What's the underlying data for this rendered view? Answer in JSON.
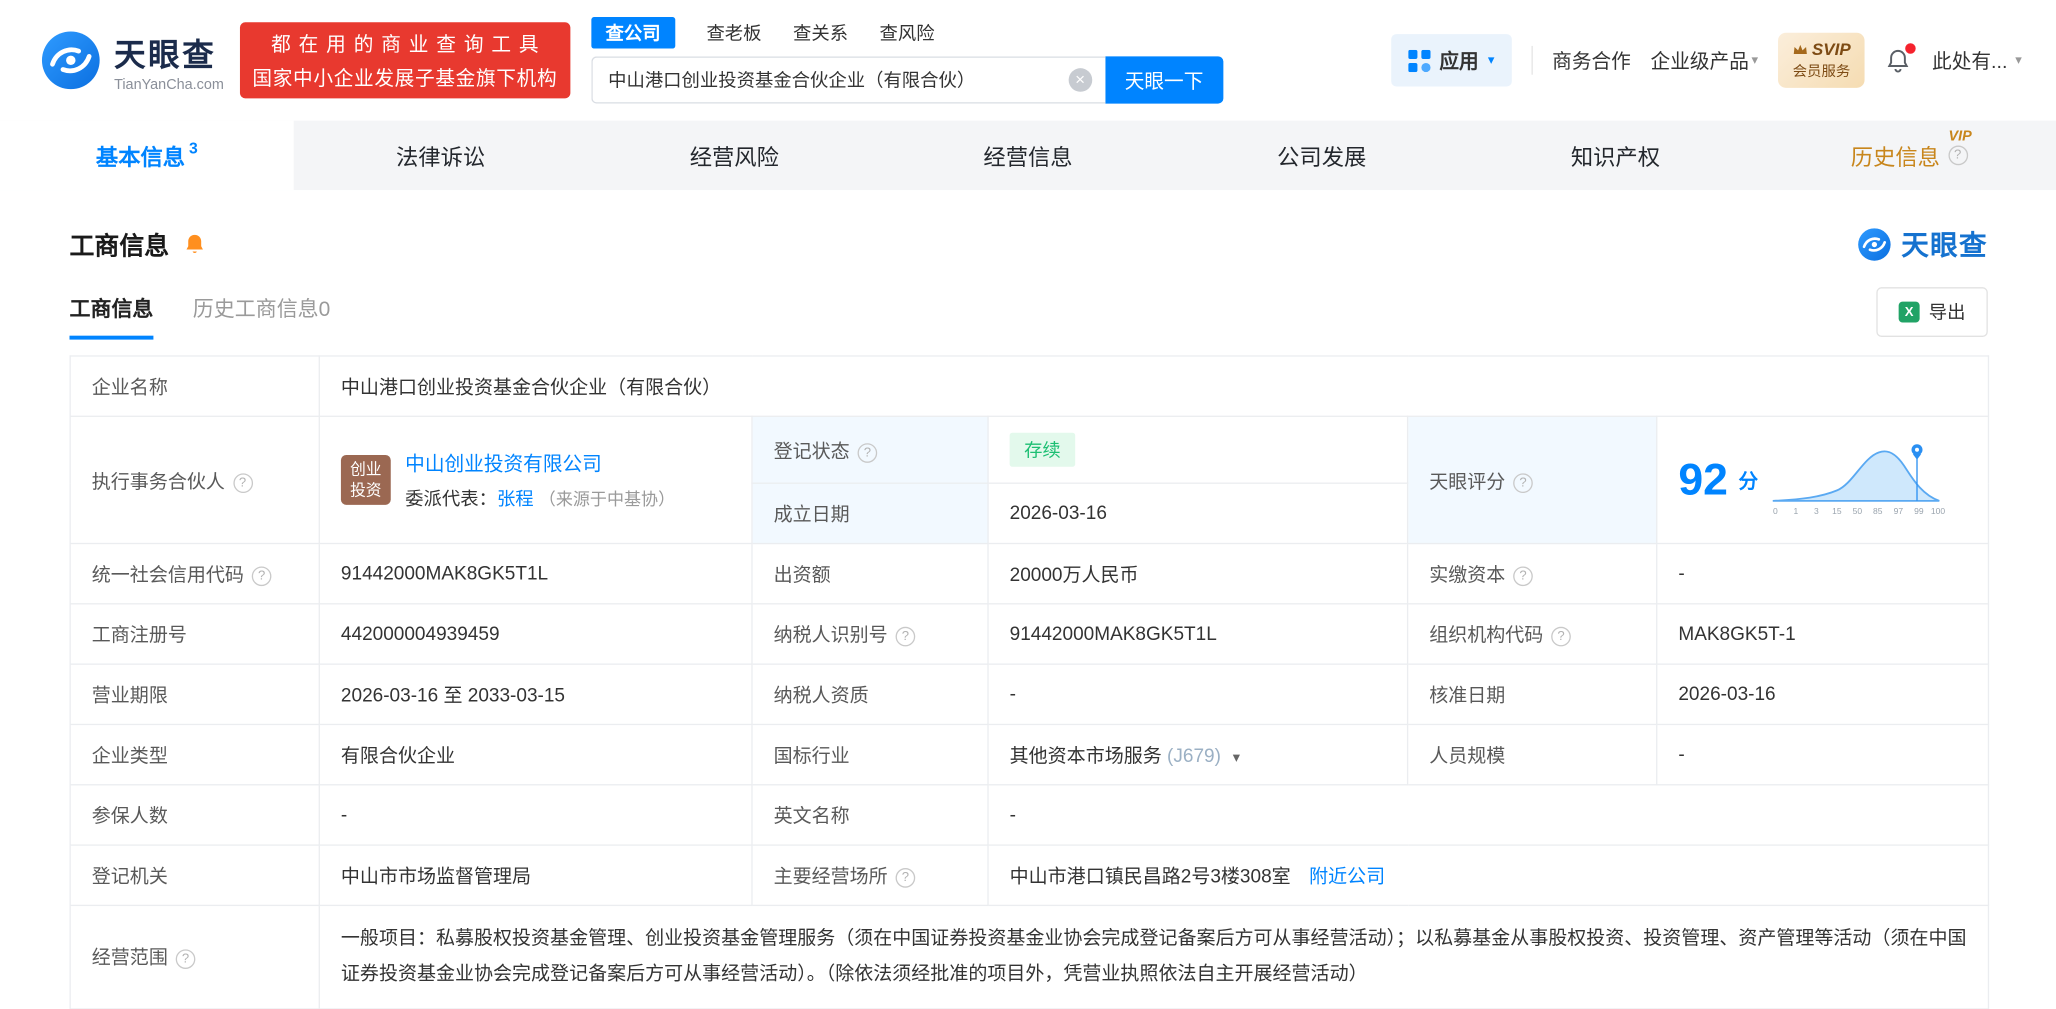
{
  "colors": {
    "accent": "#0084ff",
    "promo_red": "#e8392f",
    "gold": "#c8861c",
    "green": "#1dbf73",
    "brown": "#9b6852"
  },
  "icons": {
    "help": "?",
    "chevron_down": "▾",
    "clear": "×"
  },
  "header": {
    "brand": {
      "name": "天眼查",
      "domain": "TianYanCha.com"
    },
    "promo": {
      "line1": "都在用的商业查询工具",
      "line2": "国家中小企业发展子基金旗下机构"
    },
    "search": {
      "tabs": [
        {
          "label": "查公司"
        },
        {
          "label": "查老板"
        },
        {
          "label": "查关系"
        },
        {
          "label": "查风险"
        }
      ],
      "value": "中山港口创业投资基金合伙企业（有限合伙）",
      "button": "天眼一下"
    },
    "apps_label": "应用",
    "biz_link": "商务合作",
    "enterprise_link": "企业级产品",
    "svip": {
      "top": "SVIP",
      "bottom": "会员服务"
    },
    "more": "此处有..."
  },
  "nav": {
    "tabs": [
      {
        "label": "基本信息",
        "count": "3"
      },
      {
        "label": "法律诉讼"
      },
      {
        "label": "经营风险"
      },
      {
        "label": "经营信息"
      },
      {
        "label": "公司发展"
      },
      {
        "label": "知识产权"
      },
      {
        "label": "历史信息",
        "vip": "VIP"
      }
    ]
  },
  "section": {
    "title": "工商信息",
    "watermark": "天眼查",
    "subtabs": [
      {
        "label": "工商信息"
      },
      {
        "label": "历史工商信息0"
      }
    ],
    "export_label": "导出"
  },
  "table": {
    "company_name": {
      "label": "企业名称",
      "value": "中山港口创业投资基金合伙企业（有限合伙）"
    },
    "partner": {
      "label": "执行事务合伙人",
      "badge_line1": "创业",
      "badge_line2": "投资",
      "name": "中山创业投资有限公司",
      "rep_label": "委派代表：",
      "rep_name": "张程",
      "rep_note": "（来源于中基协）"
    },
    "reg_status": {
      "label": "登记状态",
      "value": "存续"
    },
    "establish_date": {
      "label": "成立日期",
      "value": "2026-03-16"
    },
    "score": {
      "label": "天眼评分",
      "value": "92",
      "unit": "分",
      "axis": [
        "0",
        "1",
        "3",
        "15",
        "50",
        "85",
        "97",
        "99",
        "100"
      ]
    },
    "credit_code": {
      "label": "统一社会信用代码",
      "value": "91442000MAK8GK5T1L"
    },
    "capital": {
      "label": "出资额",
      "value": "20000万人民币"
    },
    "paid_capital": {
      "label": "实缴资本",
      "value": "-"
    },
    "reg_number": {
      "label": "工商注册号",
      "value": "442000004939459"
    },
    "taxpayer_id": {
      "label": "纳税人识别号",
      "value": "91442000MAK8GK5T1L"
    },
    "org_code": {
      "label": "组织机构代码",
      "value": "MAK8GK5T-1"
    },
    "business_term": {
      "label": "营业期限",
      "value": "2026-03-16 至 2033-03-15"
    },
    "taxpayer_quality": {
      "label": "纳税人资质",
      "value": "-"
    },
    "approval_date": {
      "label": "核准日期",
      "value": "2026-03-16"
    },
    "company_type": {
      "label": "企业类型",
      "value": "有限合伙企业"
    },
    "industry": {
      "label": "国标行业",
      "value": "其他资本市场服务",
      "code": "(J679)"
    },
    "staff_size": {
      "label": "人员规模",
      "value": "-"
    },
    "insured_count": {
      "label": "参保人数",
      "value": "-"
    },
    "english_name": {
      "label": "英文名称",
      "value": "-"
    },
    "reg_authority": {
      "label": "登记机关",
      "value": "中山市市场监督管理局"
    },
    "business_address": {
      "label": "主要经营场所",
      "value": "中山市港口镇民昌路2号3楼308室",
      "nearby_link": "附近公司"
    },
    "business_scope": {
      "label": "经营范围",
      "value": "一般项目：私募股权投资基金管理、创业投资基金管理服务（须在中国证券投资基金业协会完成登记备案后方可从事经营活动）；以私募基金从事股权投资、投资管理、资产管理等活动（须在中国证券投资基金业协会完成登记备案后方可从事经营活动）。（除依法须经批准的项目外，凭营业执照依法自主开展经营活动）"
    }
  }
}
